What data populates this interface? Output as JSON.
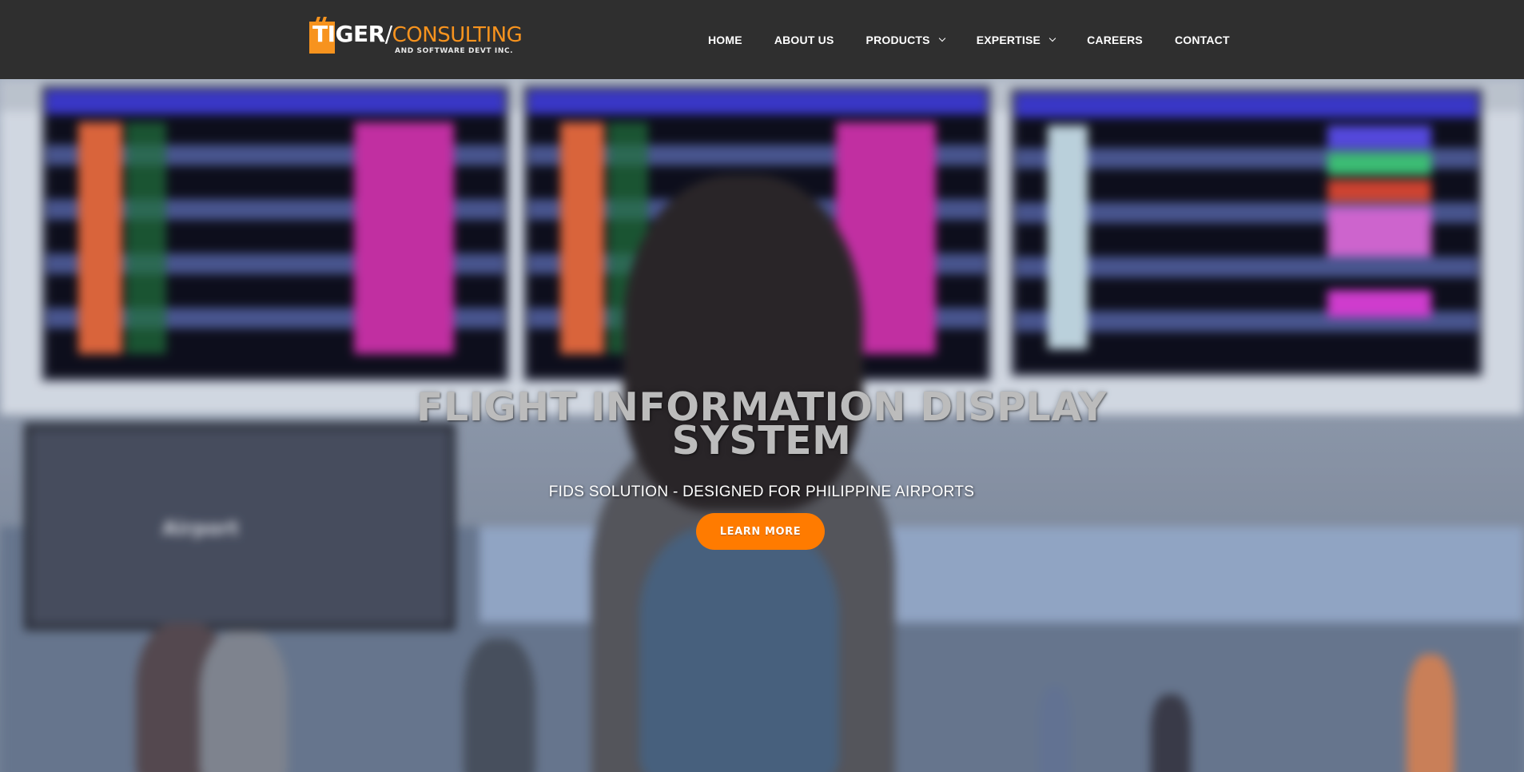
{
  "brand": {
    "name_part1": "TIGER",
    "slash": "/",
    "name_part2": "CONSULTING",
    "tagline": "AND SOFTWARE DEVT INC.",
    "accent_color": "#f7931e"
  },
  "nav": {
    "items": [
      {
        "label": "HOME",
        "has_dropdown": false
      },
      {
        "label": "ABOUT US",
        "has_dropdown": false
      },
      {
        "label": "PRODUCTS",
        "has_dropdown": true
      },
      {
        "label": "EXPERTISE",
        "has_dropdown": true
      },
      {
        "label": "CAREERS",
        "has_dropdown": false
      },
      {
        "label": "CONTACT",
        "has_dropdown": false
      }
    ]
  },
  "hero": {
    "title": "FLIGHT INFORMATION DISPLAY SYSTEM",
    "subtitle": "FIDS SOLUTION - DESIGNED FOR PHILIPPINE AIRPORTS",
    "cta_label": "LEARN MORE",
    "cta_color": "#ff7b00",
    "background_screen_text": "Airport"
  },
  "colors": {
    "header_bg": "#2f2f2f",
    "nav_text": "#ffffff"
  }
}
